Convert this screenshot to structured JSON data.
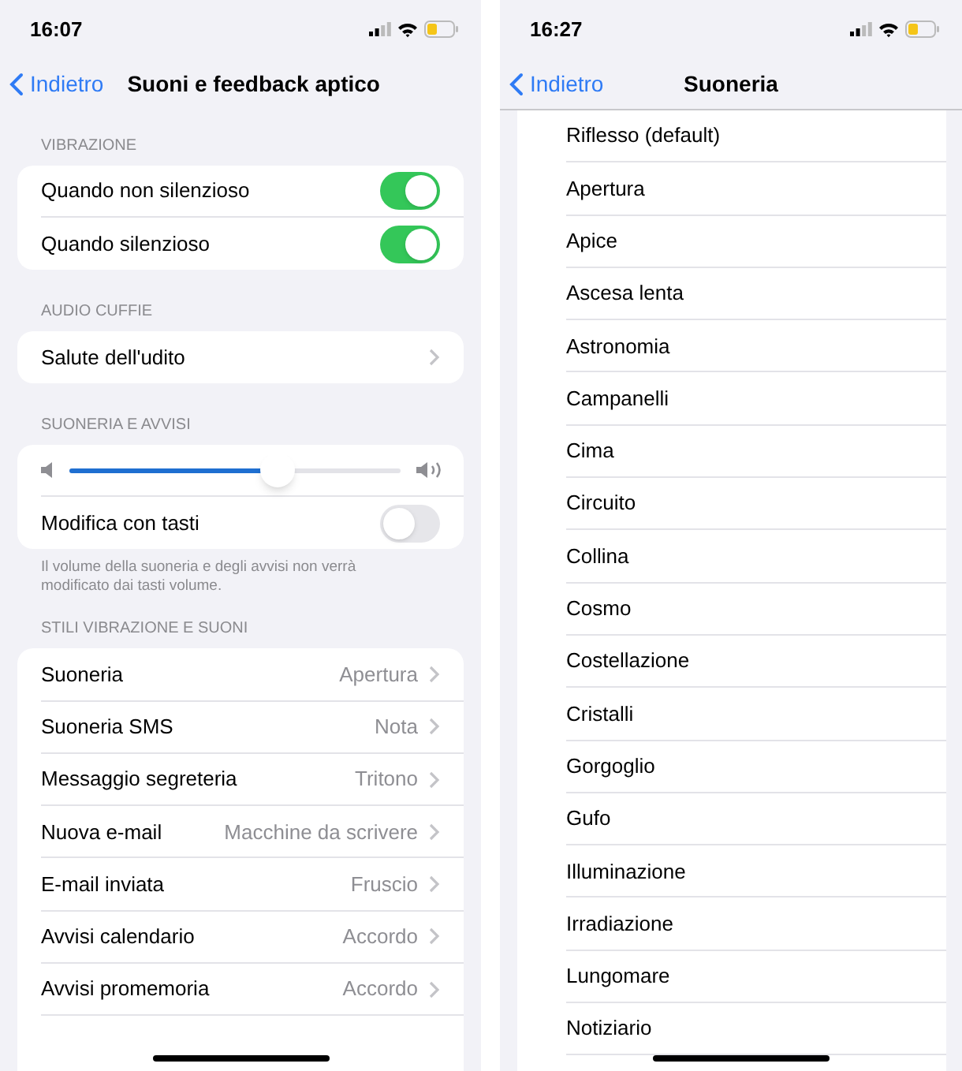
{
  "left": {
    "time": "16:07",
    "back": "Indietro",
    "title": "Suoni e feedback aptico",
    "groups": [
      {
        "header": "VIBRAZIONE",
        "rows": [
          {
            "kind": "toggle",
            "label": "Quando non silenzioso",
            "on": true
          },
          {
            "kind": "toggle",
            "label": "Quando silenzioso",
            "on": true
          }
        ]
      },
      {
        "header": "AUDIO CUFFIE",
        "rows": [
          {
            "kind": "link",
            "label": "Salute dell'udito"
          }
        ]
      },
      {
        "header": "SUONERIA E AVVISI",
        "rows": [
          {
            "kind": "slider",
            "level": 0.63
          },
          {
            "kind": "toggle",
            "label": "Modifica con tasti",
            "on": false
          }
        ],
        "footer": "Il volume della suoneria e degli avvisi non verrà modificato dai tasti volume."
      },
      {
        "header": "STILI VIBRAZIONE E SUONI",
        "rows": [
          {
            "kind": "link",
            "label": "Suoneria",
            "value": "Apertura"
          },
          {
            "kind": "link",
            "label": "Suoneria SMS",
            "value": "Nota"
          },
          {
            "kind": "link",
            "label": "Messaggio segreteria",
            "value": "Tritono"
          },
          {
            "kind": "link",
            "label": "Nuova e-mail",
            "value": "Macchine da scrivere"
          },
          {
            "kind": "link",
            "label": "E-mail inviata",
            "value": "Fruscio"
          },
          {
            "kind": "link",
            "label": "Avvisi calendario",
            "value": "Accordo"
          },
          {
            "kind": "link",
            "label": "Avvisi promemoria",
            "value": "Accordo"
          }
        ],
        "cut": true
      }
    ]
  },
  "right": {
    "time": "16:27",
    "back": "Indietro",
    "title": "Suoneria",
    "tones": [
      "Riflesso (default)",
      "Apertura",
      "Apice",
      "Ascesa lenta",
      "Astronomia",
      "Campanelli",
      "Cima",
      "Circuito",
      "Collina",
      "Cosmo",
      "Costellazione",
      "Cristalli",
      "Gorgoglio",
      "Gufo",
      "Illuminazione",
      "Irradiazione",
      "Lungomare",
      "Notiziario"
    ]
  }
}
